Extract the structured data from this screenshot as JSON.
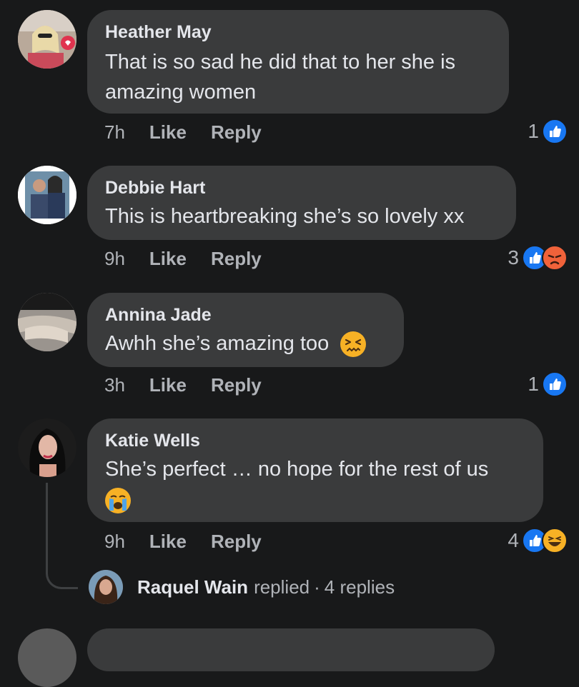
{
  "comments": [
    {
      "author": "Heather May",
      "text": "That is so sad he did that to her she is amazing women",
      "time": "7h",
      "like_label": "Like",
      "reply_label": "Reply",
      "reaction_count": "1",
      "reactions": [
        "like"
      ]
    },
    {
      "author": "Debbie Hart",
      "text": "This is heartbreaking she’s so lovely xx",
      "time": "9h",
      "like_label": "Like",
      "reply_label": "Reply",
      "reaction_count": "3",
      "reactions": [
        "like",
        "angry"
      ]
    },
    {
      "author": "Annina Jade",
      "text": "Awhh she’s amazing too",
      "emoji": "confounded-face",
      "time": "3h",
      "like_label": "Like",
      "reply_label": "Reply",
      "reaction_count": "1",
      "reactions": [
        "like"
      ]
    },
    {
      "author": "Katie Wells",
      "text": "She’s perfect … no hope for the rest of us",
      "emoji": "loudly-crying-face",
      "time": "9h",
      "like_label": "Like",
      "reply_label": "Reply",
      "reaction_count": "4",
      "reactions": [
        "like",
        "haha"
      ]
    }
  ],
  "replies": {
    "name": "Raquel Wain",
    "action": "replied",
    "separator": "·",
    "count_label": "4 replies"
  },
  "colors": {
    "background": "#18191a",
    "bubble": "#3a3b3c",
    "like": "#1877f2",
    "angry": "#f0623a",
    "haha": "#f7b125"
  }
}
